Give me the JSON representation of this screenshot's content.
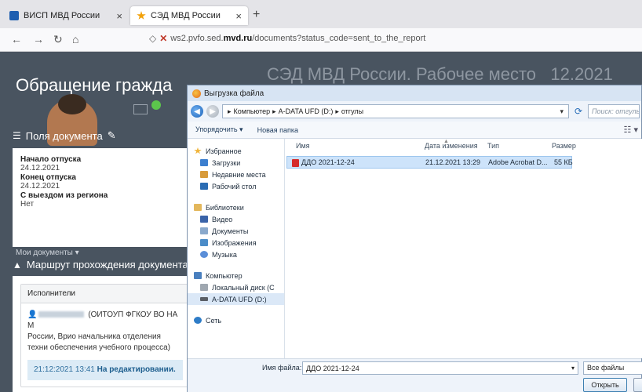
{
  "browser": {
    "tabs": [
      {
        "label": "ВИСП МВД России",
        "close": "×"
      },
      {
        "label": "СЭД МВД России",
        "close": "×"
      }
    ],
    "new_tab": "+",
    "url_prefix": "ws2.pvfo.sed.",
    "url_domain": "mvd.ru",
    "url_suffix": "/documents?status_code=sent_to_the_report"
  },
  "page": {
    "header_title": "СЭД МВД России. Рабочее место",
    "header_date": "12.2021",
    "heading": "Обращение гражда",
    "fields_title": "Поля документа",
    "fields": [
      {
        "label": "Начало отпуска",
        "value": "24.12.2021"
      },
      {
        "label": "Конец отпуска",
        "value": "24.12.2021"
      },
      {
        "label": "С выездом из региона",
        "value": "Нет"
      }
    ],
    "my_docs": "Мои документы",
    "route_title": "Маршрут прохождения документа",
    "executors_label": "Исполнители",
    "executor_text_before": "(ОИТОУП ФГКОУ ВО НА М",
    "executor_text_rest": "России, Врио начальника отделения техни обеспечения учебного процесса)",
    "status_time": "21:12:2021 13:41",
    "status_text": "На редактировании."
  },
  "dialog": {
    "title": "Выгрузка файла",
    "path": [
      "Компьютер",
      "A-DATA UFD (D:)",
      "отгулы"
    ],
    "search_placeholder": "Поиск: отгулы",
    "toolbar": {
      "organize": "Упорядочить ▾",
      "new_folder": "Новая папка"
    },
    "nav": {
      "favorites": "Избранное",
      "downloads": "Загрузки",
      "recent": "Недавние места",
      "desktop": "Рабочий стол",
      "libraries": "Библиотеки",
      "video": "Видео",
      "documents": "Документы",
      "images": "Изображения",
      "music": "Музыка",
      "computer": "Компьютер",
      "local_disk": "Локальный диск (C",
      "usb": "A-DATA UFD (D:)",
      "network": "Сеть"
    },
    "columns": {
      "name": "Имя",
      "date": "Дата изменения",
      "type": "Тип",
      "size": "Размер"
    },
    "files": [
      {
        "name": "ДДО 2021-12-24",
        "date": "21.12.2021 13:29",
        "type": "Adobe Acrobat D...",
        "size": "55 КБ"
      }
    ],
    "filename_label": "Имя файла:",
    "filename_value": "ДДО 2021-12-24",
    "filter_value": "Все файлы",
    "open_button": "Открыть"
  }
}
